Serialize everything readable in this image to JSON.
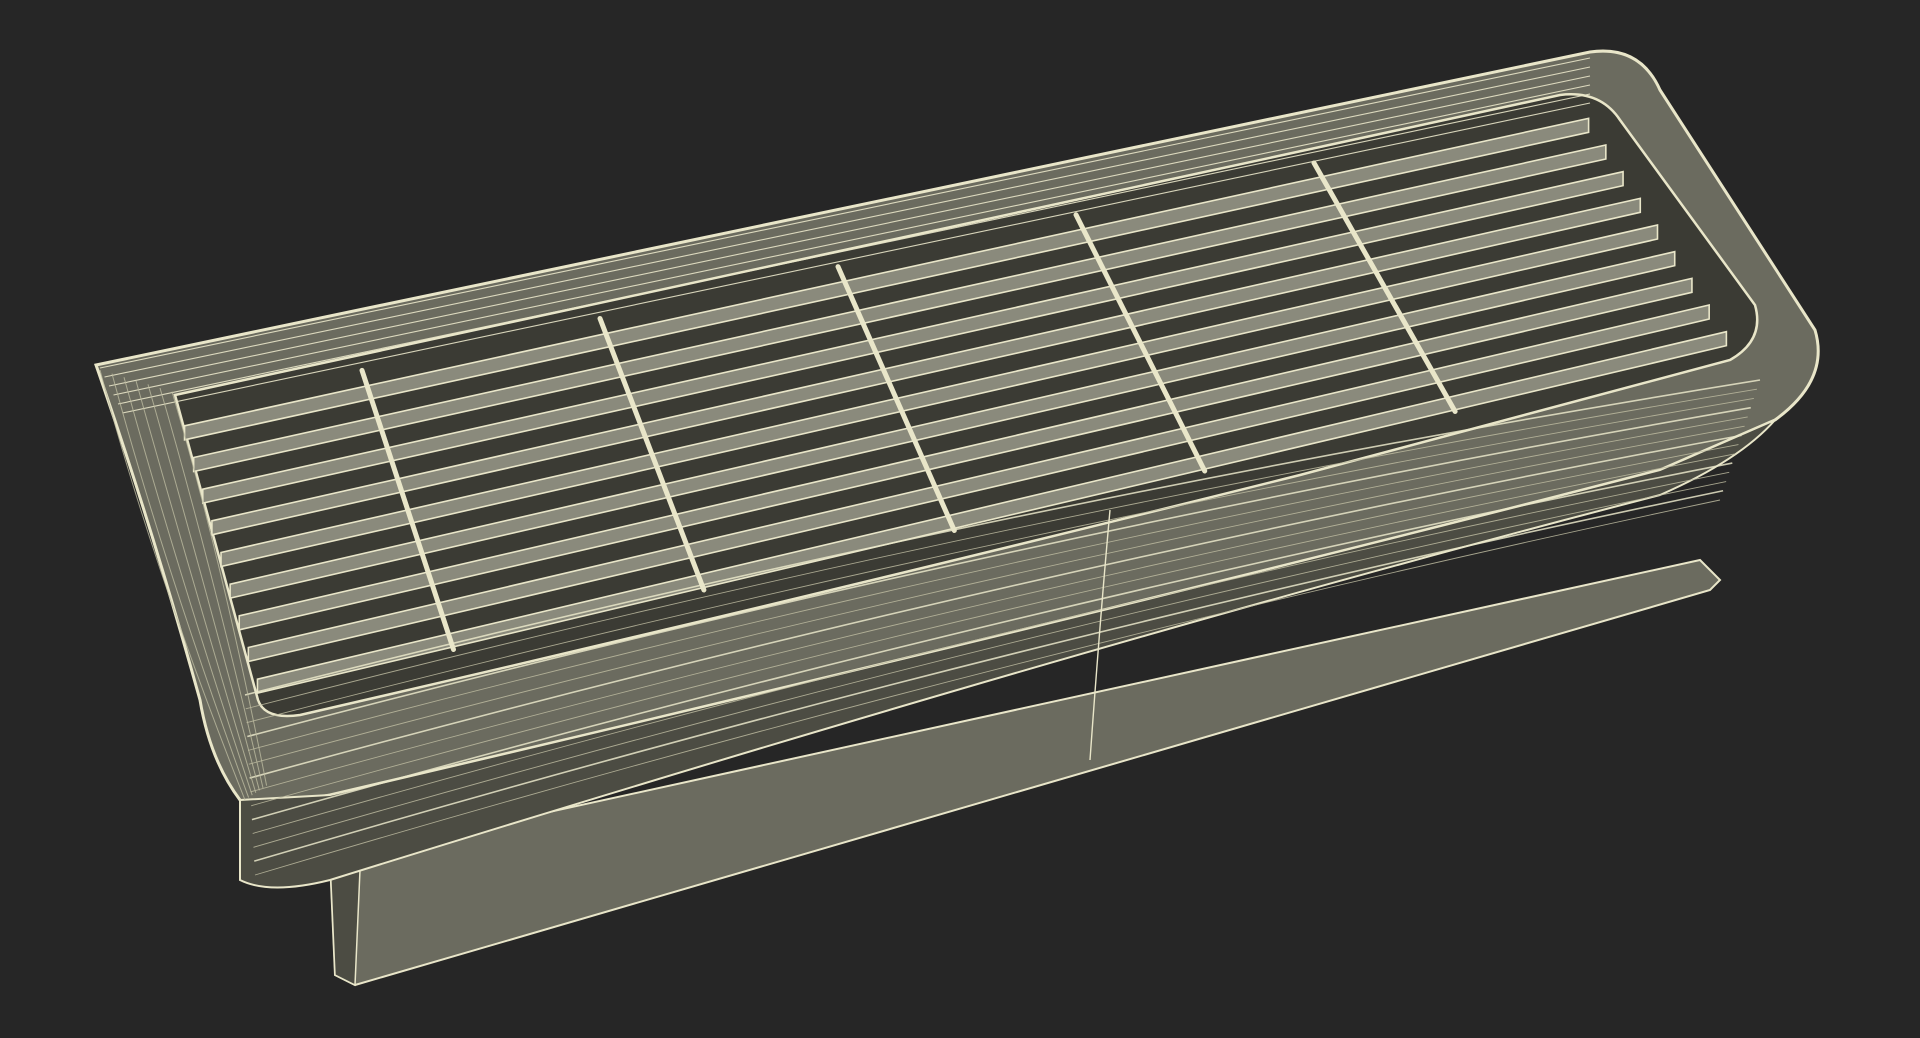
{
  "scene": {
    "subject": "ac-unit-wireframe",
    "colors": {
      "background": "#262626",
      "body_fill": "#6b6b5f",
      "body_shade": "#4c4c43",
      "body_light": "#8a8a7c",
      "wire": "#e9e6c9",
      "wire_dim": "#bdbba0",
      "vent_dark": "#3b3b34"
    },
    "louver_count": 9,
    "wire_segments_long": 14
  }
}
